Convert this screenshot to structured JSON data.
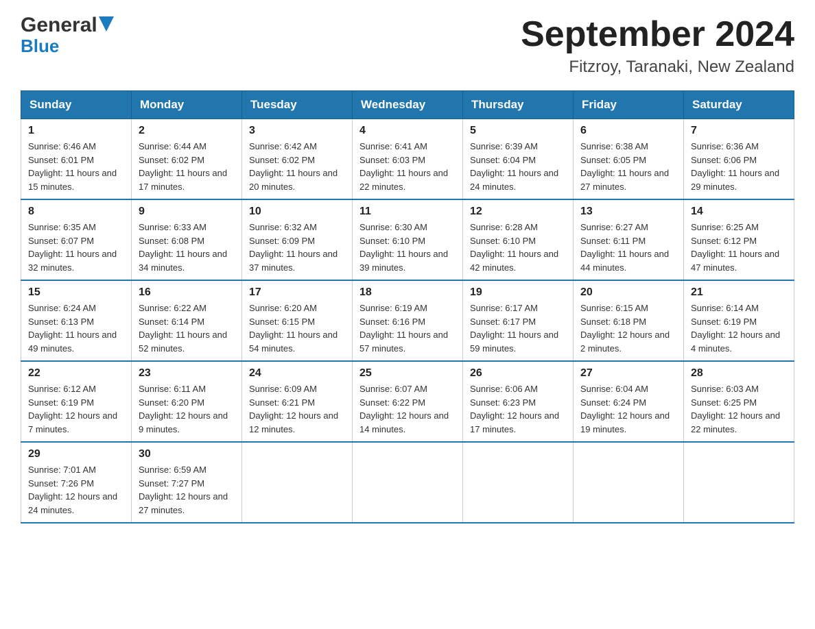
{
  "header": {
    "logo_general": "General",
    "logo_blue": "Blue",
    "title": "September 2024",
    "subtitle": "Fitzroy, Taranaki, New Zealand"
  },
  "days_of_week": [
    "Sunday",
    "Monday",
    "Tuesday",
    "Wednesday",
    "Thursday",
    "Friday",
    "Saturday"
  ],
  "weeks": [
    [
      {
        "day": "1",
        "sunrise": "Sunrise: 6:46 AM",
        "sunset": "Sunset: 6:01 PM",
        "daylight": "Daylight: 11 hours and 15 minutes."
      },
      {
        "day": "2",
        "sunrise": "Sunrise: 6:44 AM",
        "sunset": "Sunset: 6:02 PM",
        "daylight": "Daylight: 11 hours and 17 minutes."
      },
      {
        "day": "3",
        "sunrise": "Sunrise: 6:42 AM",
        "sunset": "Sunset: 6:02 PM",
        "daylight": "Daylight: 11 hours and 20 minutes."
      },
      {
        "day": "4",
        "sunrise": "Sunrise: 6:41 AM",
        "sunset": "Sunset: 6:03 PM",
        "daylight": "Daylight: 11 hours and 22 minutes."
      },
      {
        "day": "5",
        "sunrise": "Sunrise: 6:39 AM",
        "sunset": "Sunset: 6:04 PM",
        "daylight": "Daylight: 11 hours and 24 minutes."
      },
      {
        "day": "6",
        "sunrise": "Sunrise: 6:38 AM",
        "sunset": "Sunset: 6:05 PM",
        "daylight": "Daylight: 11 hours and 27 minutes."
      },
      {
        "day": "7",
        "sunrise": "Sunrise: 6:36 AM",
        "sunset": "Sunset: 6:06 PM",
        "daylight": "Daylight: 11 hours and 29 minutes."
      }
    ],
    [
      {
        "day": "8",
        "sunrise": "Sunrise: 6:35 AM",
        "sunset": "Sunset: 6:07 PM",
        "daylight": "Daylight: 11 hours and 32 minutes."
      },
      {
        "day": "9",
        "sunrise": "Sunrise: 6:33 AM",
        "sunset": "Sunset: 6:08 PM",
        "daylight": "Daylight: 11 hours and 34 minutes."
      },
      {
        "day": "10",
        "sunrise": "Sunrise: 6:32 AM",
        "sunset": "Sunset: 6:09 PM",
        "daylight": "Daylight: 11 hours and 37 minutes."
      },
      {
        "day": "11",
        "sunrise": "Sunrise: 6:30 AM",
        "sunset": "Sunset: 6:10 PM",
        "daylight": "Daylight: 11 hours and 39 minutes."
      },
      {
        "day": "12",
        "sunrise": "Sunrise: 6:28 AM",
        "sunset": "Sunset: 6:10 PM",
        "daylight": "Daylight: 11 hours and 42 minutes."
      },
      {
        "day": "13",
        "sunrise": "Sunrise: 6:27 AM",
        "sunset": "Sunset: 6:11 PM",
        "daylight": "Daylight: 11 hours and 44 minutes."
      },
      {
        "day": "14",
        "sunrise": "Sunrise: 6:25 AM",
        "sunset": "Sunset: 6:12 PM",
        "daylight": "Daylight: 11 hours and 47 minutes."
      }
    ],
    [
      {
        "day": "15",
        "sunrise": "Sunrise: 6:24 AM",
        "sunset": "Sunset: 6:13 PM",
        "daylight": "Daylight: 11 hours and 49 minutes."
      },
      {
        "day": "16",
        "sunrise": "Sunrise: 6:22 AM",
        "sunset": "Sunset: 6:14 PM",
        "daylight": "Daylight: 11 hours and 52 minutes."
      },
      {
        "day": "17",
        "sunrise": "Sunrise: 6:20 AM",
        "sunset": "Sunset: 6:15 PM",
        "daylight": "Daylight: 11 hours and 54 minutes."
      },
      {
        "day": "18",
        "sunrise": "Sunrise: 6:19 AM",
        "sunset": "Sunset: 6:16 PM",
        "daylight": "Daylight: 11 hours and 57 minutes."
      },
      {
        "day": "19",
        "sunrise": "Sunrise: 6:17 AM",
        "sunset": "Sunset: 6:17 PM",
        "daylight": "Daylight: 11 hours and 59 minutes."
      },
      {
        "day": "20",
        "sunrise": "Sunrise: 6:15 AM",
        "sunset": "Sunset: 6:18 PM",
        "daylight": "Daylight: 12 hours and 2 minutes."
      },
      {
        "day": "21",
        "sunrise": "Sunrise: 6:14 AM",
        "sunset": "Sunset: 6:19 PM",
        "daylight": "Daylight: 12 hours and 4 minutes."
      }
    ],
    [
      {
        "day": "22",
        "sunrise": "Sunrise: 6:12 AM",
        "sunset": "Sunset: 6:19 PM",
        "daylight": "Daylight: 12 hours and 7 minutes."
      },
      {
        "day": "23",
        "sunrise": "Sunrise: 6:11 AM",
        "sunset": "Sunset: 6:20 PM",
        "daylight": "Daylight: 12 hours and 9 minutes."
      },
      {
        "day": "24",
        "sunrise": "Sunrise: 6:09 AM",
        "sunset": "Sunset: 6:21 PM",
        "daylight": "Daylight: 12 hours and 12 minutes."
      },
      {
        "day": "25",
        "sunrise": "Sunrise: 6:07 AM",
        "sunset": "Sunset: 6:22 PM",
        "daylight": "Daylight: 12 hours and 14 minutes."
      },
      {
        "day": "26",
        "sunrise": "Sunrise: 6:06 AM",
        "sunset": "Sunset: 6:23 PM",
        "daylight": "Daylight: 12 hours and 17 minutes."
      },
      {
        "day": "27",
        "sunrise": "Sunrise: 6:04 AM",
        "sunset": "Sunset: 6:24 PM",
        "daylight": "Daylight: 12 hours and 19 minutes."
      },
      {
        "day": "28",
        "sunrise": "Sunrise: 6:03 AM",
        "sunset": "Sunset: 6:25 PM",
        "daylight": "Daylight: 12 hours and 22 minutes."
      }
    ],
    [
      {
        "day": "29",
        "sunrise": "Sunrise: 7:01 AM",
        "sunset": "Sunset: 7:26 PM",
        "daylight": "Daylight: 12 hours and 24 minutes."
      },
      {
        "day": "30",
        "sunrise": "Sunrise: 6:59 AM",
        "sunset": "Sunset: 7:27 PM",
        "daylight": "Daylight: 12 hours and 27 minutes."
      },
      null,
      null,
      null,
      null,
      null
    ]
  ]
}
